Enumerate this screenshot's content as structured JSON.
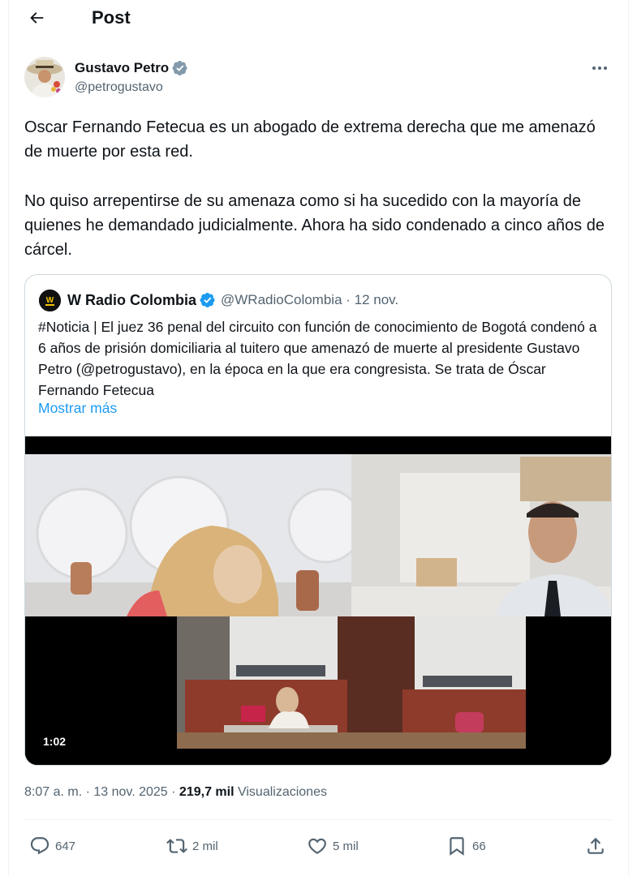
{
  "header": {
    "title": "Post"
  },
  "author": {
    "name": "Gustavo Petro",
    "handle": "@petrogustavo"
  },
  "post": {
    "paragraph_1": "Oscar Fernando Fetecua es un abogado de extrema derecha que me amenazó de muerte por esta red.",
    "paragraph_2": "No quiso arrepentirse de su amenaza como si ha sucedido con la mayoría de quienes he demandado judicialmente. Ahora ha sido condenado a cinco años de cárcel."
  },
  "quote": {
    "name": "W Radio Colombia",
    "handle_date": "@WRadioColombia · 12 nov.",
    "text": "#Noticia | El juez 36 penal del circuito con función de conocimiento de Bogotá condenó a 6 años de prisión domiciliaria al tuitero que amenazó de muerte al presidente Gustavo Petro (@petrogustavo), en la época en la que era congresista. Se trata de Óscar Fernando Fetecua",
    "show_more": "Mostrar más",
    "video_duration": "1:02"
  },
  "meta": {
    "time_date": "8:07 a. m. · 13 nov. 2025 · ",
    "views_count": "219,7 mil",
    "views_label": " Visualizaciones"
  },
  "actions": {
    "replies": "647",
    "reposts": "2 mil",
    "likes": "5 mil",
    "bookmarks": "66"
  },
  "colors": {
    "accent": "#1d9bf0",
    "text": "#0f1419",
    "secondary": "#536471",
    "border": "#cfd9de"
  },
  "icons": [
    "back-arrow-icon",
    "verified-badge-icon",
    "more-icon",
    "reply-icon",
    "repost-icon",
    "like-icon",
    "bookmark-icon",
    "share-icon"
  ]
}
